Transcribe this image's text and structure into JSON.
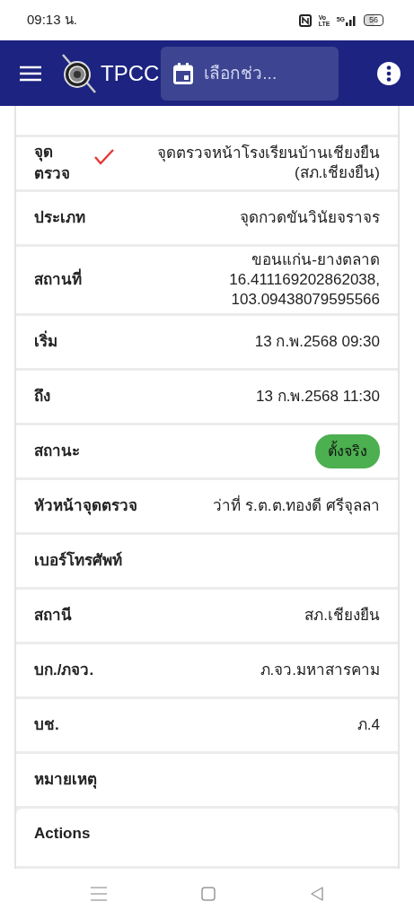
{
  "status_bar": {
    "time": "09:13 น.",
    "volte": "Vo LTE",
    "network": "5G",
    "battery": "56"
  },
  "app_bar": {
    "title": "TPCC",
    "date_field": {
      "placeholder": "เลือกช่ว..."
    }
  },
  "details": [
    {
      "label": "จุดตรวจ",
      "value": "จุดตรวจหน้าโรงเรียนบ้านเชียงยืน (สภ.เชียงยืน)",
      "kind": "checked"
    },
    {
      "label": "ประเภท",
      "value": "จุดกวดขันวินัยจราจร",
      "kind": "text"
    },
    {
      "label": "สถานที่",
      "value": "ขอนแก่น-ยางตลาด 16.411169202862038, 103.09438079595566",
      "kind": "text"
    },
    {
      "label": "เริ่ม",
      "value": "13 ก.พ.2568 09:30",
      "kind": "text"
    },
    {
      "label": "ถึง",
      "value": "13 ก.พ.2568 11:30",
      "kind": "text"
    },
    {
      "label": "สถานะ",
      "value": "ตั้งจริง",
      "kind": "badge",
      "color": "#4caf50"
    },
    {
      "label": "หัวหน้าจุดตรวจ",
      "value": "ว่าที่ ร.ต.ต.ทองดี ศรีจุลลา",
      "kind": "text"
    },
    {
      "label": "เบอร์โทรศัพท์",
      "kind": "text"
    },
    {
      "label": "สถานี",
      "value": "สภ.เชียงยืน",
      "kind": "text"
    },
    {
      "label": "บก./ภจว.",
      "value": "ภ.จว.มหาสารคาม",
      "kind": "text"
    },
    {
      "label": "บช.",
      "value": "ภ.4",
      "kind": "text"
    },
    {
      "label": "หมายเหตุ",
      "kind": "text"
    }
  ],
  "actions": {
    "title": "Actions"
  }
}
